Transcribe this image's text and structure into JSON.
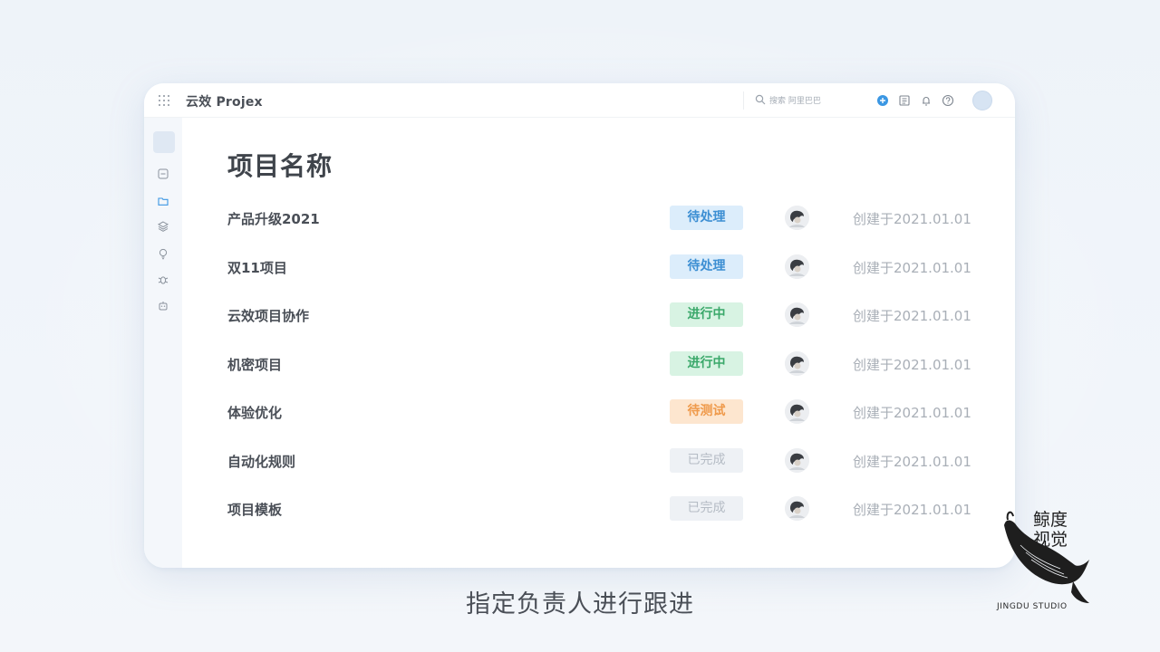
{
  "app": {
    "title": "云效 Projex",
    "search_placeholder": "搜索 阿里巴巴"
  },
  "topbar_icons": [
    "apps-icon",
    "search-icon",
    "add-icon",
    "document-icon",
    "bell-icon",
    "help-icon",
    "avatar"
  ],
  "sidebar": {
    "items": [
      {
        "name": "logo"
      },
      {
        "name": "workitem-icon"
      },
      {
        "name": "project-folder-icon",
        "active": true
      },
      {
        "name": "layers-icon"
      },
      {
        "name": "bulb-icon"
      },
      {
        "name": "bug-icon"
      },
      {
        "name": "robot-icon"
      }
    ]
  },
  "main": {
    "page_title": "项目名称",
    "rows": [
      {
        "name": "产品升级2021",
        "status": "待处理",
        "status_type": "pending",
        "created": "创建于2021.01.01"
      },
      {
        "name": "双11项目",
        "status": "待处理",
        "status_type": "pending",
        "created": "创建于2021.01.01"
      },
      {
        "name": "云效项目协作",
        "status": "进行中",
        "status_type": "progress",
        "created": "创建于2021.01.01"
      },
      {
        "name": "机密项目",
        "status": "进行中",
        "status_type": "progress",
        "created": "创建于2021.01.01"
      },
      {
        "name": "体验优化",
        "status": "待测试",
        "status_type": "testing",
        "created": "创建于2021.01.01"
      },
      {
        "name": "自动化规则",
        "status": "已完成",
        "status_type": "done",
        "created": "创建于2021.01.01"
      },
      {
        "name": "项目模板",
        "status": "已完成",
        "status_type": "done",
        "created": "创建于2021.01.01"
      }
    ]
  },
  "caption": "指定负责人进行跟进",
  "watermark": {
    "chars": "鲸度视觉",
    "text": "JINGDU STUDIO"
  },
  "colors": {
    "pending": "#3d8fd3",
    "progress": "#3aa86a",
    "testing": "#ef9a4b",
    "done": "#b5bcc5",
    "accent": "#3b97e3"
  }
}
